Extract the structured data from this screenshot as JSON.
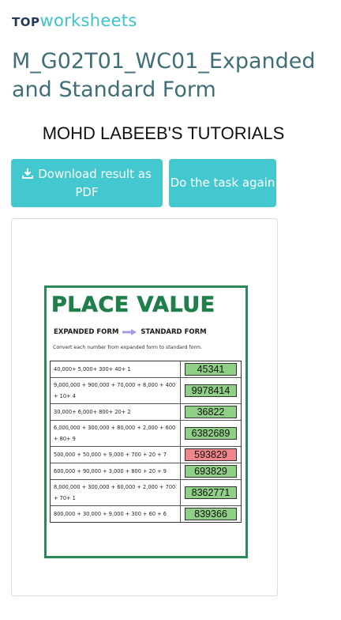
{
  "header": {
    "logo_prefix": "TOP",
    "logo_suffix": "worksheets",
    "logo_accent": "#39c5cc"
  },
  "worksheet": {
    "title": "M_G02T01_WC01_Expanded and Standard Form",
    "student_name": "MOHD LABEEB'S TUTORIALS"
  },
  "buttons": {
    "download_label": "Download result as PDF",
    "download_icon": "download-icon",
    "again_label": "Do the task again",
    "color": "#44c8cf"
  },
  "sheet": {
    "heading": "PLACE VALUE",
    "from_label": "EXPANDED FORM",
    "to_label": "STANDARD FORM",
    "instruction": "Convert each number from expanded form to standard form.",
    "rows": [
      {
        "expr": "40,000+ 5,000+ 300+ 40+ 1",
        "answer": "45341",
        "status": "correct"
      },
      {
        "expr": "9,000,000 + 900,000 + 70,000 + 8,000 + 400 + 10+ 4",
        "answer": "9978414",
        "status": "correct"
      },
      {
        "expr": "30,000+ 6,000+ 800+ 20+ 2",
        "answer": "36822",
        "status": "correct"
      },
      {
        "expr": "6,000,000 + 300,000 + 80,000 + 2,000 + 600 + 80+ 9",
        "answer": "6382689",
        "status": "correct"
      },
      {
        "expr": "500,000 + 50,000 + 9,000 + 700 + 20 + 7",
        "answer": "593829",
        "status": "wrong"
      },
      {
        "expr": "600,000 + 90,000 + 3,000 + 800 + 20 + 9",
        "answer": "693829",
        "status": "correct"
      },
      {
        "expr": "8,000,000 + 300,000 + 60,000 + 2,000 + 700 + 70+ 1",
        "answer": "8362771",
        "status": "correct"
      },
      {
        "expr": "800,000 + 30,000 + 9,000 + 300 + 60 + 6",
        "answer": "839366",
        "status": "correct"
      }
    ],
    "correct_color": "#8fcf86",
    "wrong_color": "#f0868b"
  }
}
